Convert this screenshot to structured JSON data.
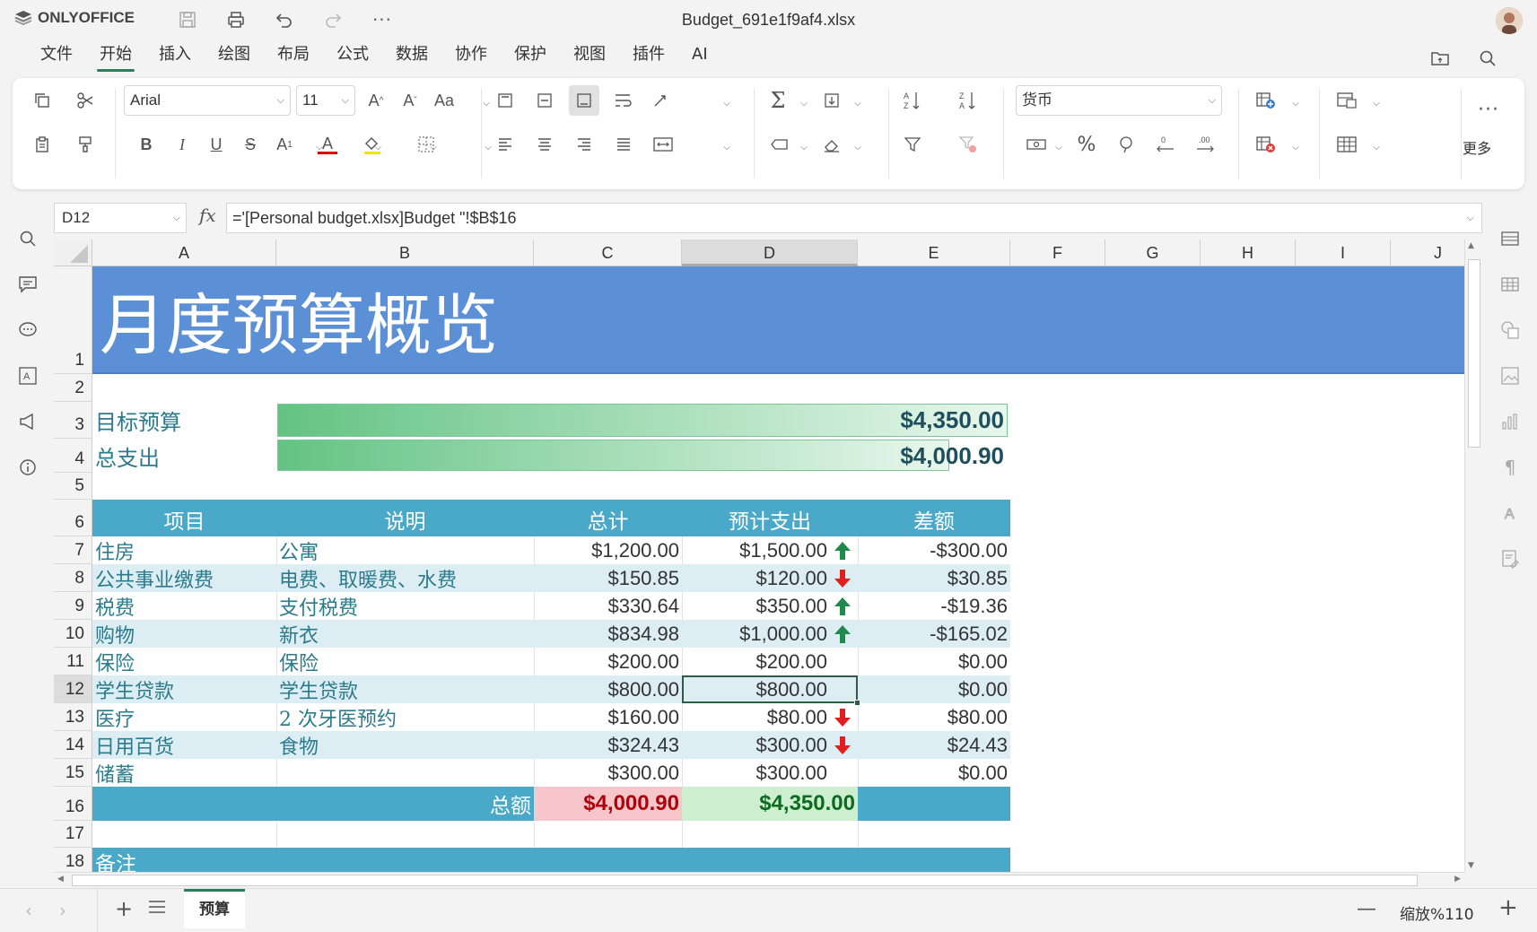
{
  "app": {
    "brand": "ONLYOFFICE",
    "title": "Budget_691e1f9af4.xlsx"
  },
  "menu": {
    "tabs": [
      "文件",
      "开始",
      "插入",
      "绘图",
      "布局",
      "公式",
      "数据",
      "协作",
      "保护",
      "视图",
      "插件",
      "AI"
    ],
    "active": "开始"
  },
  "ribbon": {
    "font_name": "Arial",
    "font_size": "11",
    "number_format": "货币",
    "more_label": "更多"
  },
  "formula_bar": {
    "name_box": "D12",
    "fx_label": "fx",
    "formula": "='[Personal budget.xlsx]Budget \"!$B$16"
  },
  "columns": [
    "A",
    "B",
    "C",
    "D",
    "E",
    "F",
    "G",
    "H",
    "I",
    "J"
  ],
  "rows": [
    "1",
    "2",
    "3",
    "4",
    "5",
    "6",
    "7",
    "8",
    "9",
    "10",
    "11",
    "12",
    "13",
    "14",
    "15",
    "16",
    "17",
    "18"
  ],
  "sheet": {
    "title": "月度预算概览",
    "target_label": "目标预算",
    "target_value": "$4,350.00",
    "target_fill": 1.0,
    "spent_label": "总支出",
    "spent_value": "$4,000.90",
    "spent_fill": 0.92,
    "headers": {
      "item": "项目",
      "desc": "说明",
      "total": "总计",
      "projected": "预计支出",
      "diff": "差额"
    },
    "items": [
      {
        "item": "住房",
        "desc": "公寓",
        "total": "$1,200.00",
        "projected": "$1,500.00",
        "trend": "up",
        "diff": "-$300.00"
      },
      {
        "item": "公共事业缴费",
        "desc": "电费、取暖费、水费",
        "total": "$150.85",
        "projected": "$120.00",
        "trend": "down",
        "diff": "$30.85"
      },
      {
        "item": "税费",
        "desc": "支付税费",
        "total": "$330.64",
        "projected": "$350.00",
        "trend": "up",
        "diff": "-$19.36"
      },
      {
        "item": "购物",
        "desc": "新衣",
        "total": "$834.98",
        "projected": "$1,000.00",
        "trend": "up",
        "diff": "-$165.02"
      },
      {
        "item": "保险",
        "desc": "保险",
        "total": "$200.00",
        "projected": "$200.00",
        "trend": "",
        "diff": "$0.00"
      },
      {
        "item": "学生贷款",
        "desc": "学生贷款",
        "total": "$800.00",
        "projected": "$800.00",
        "trend": "",
        "diff": "$0.00"
      },
      {
        "item": "医疗",
        "desc": "2 次牙医预约",
        "total": "$160.00",
        "projected": "$80.00",
        "trend": "down",
        "diff": "$80.00"
      },
      {
        "item": "日用百货",
        "desc": "食物",
        "total": "$324.43",
        "projected": "$300.00",
        "trend": "down",
        "diff": "$24.43"
      },
      {
        "item": "储蓄",
        "desc": "",
        "total": "$300.00",
        "projected": "$300.00",
        "trend": "",
        "diff": "$0.00"
      }
    ],
    "total_label": "总额",
    "total_sum": "$4,000.90",
    "projected_sum": "$4,350.00",
    "notes_label": "备注"
  },
  "bottom": {
    "sheet_tab": "预算",
    "zoom_label": "缩放%110"
  },
  "colors": {
    "title_band": "#5b8fd6",
    "header_band": "#4aa9c9",
    "alt_row": "#dcedf4",
    "text_teal": "#2b7b8c",
    "up_arrow": "#1f8a4c",
    "down_arrow": "#e02020",
    "total_red_bg": "#f7c6cb",
    "total_green_bg": "#cdeecf"
  }
}
